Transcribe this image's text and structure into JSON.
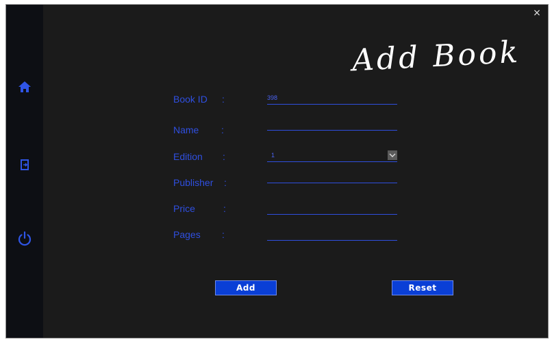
{
  "window": {
    "close_icon": "×"
  },
  "sidebar": {
    "icons": [
      "home-icon",
      "logout-icon",
      "power-icon"
    ]
  },
  "title": "Add Book",
  "form": {
    "book_id": {
      "label": "Book ID",
      "colon": ":",
      "value": "398"
    },
    "name": {
      "label": "Name",
      "colon": ":",
      "value": ""
    },
    "edition": {
      "label": "Edition",
      "colon": ":",
      "value": "1"
    },
    "publisher": {
      "label": "Publisher",
      "colon": ":",
      "value": ""
    },
    "price": {
      "label": "Price",
      "colon": ":",
      "value": ""
    },
    "pages": {
      "label": "Pages",
      "colon": ":",
      "value": ""
    }
  },
  "buttons": {
    "add": "Add",
    "reset": "Reset"
  },
  "colors": {
    "accent": "#2f4fe0",
    "button": "#0a3fd6",
    "background": "#1b1b1b",
    "sidebar": "#0d0f14"
  }
}
